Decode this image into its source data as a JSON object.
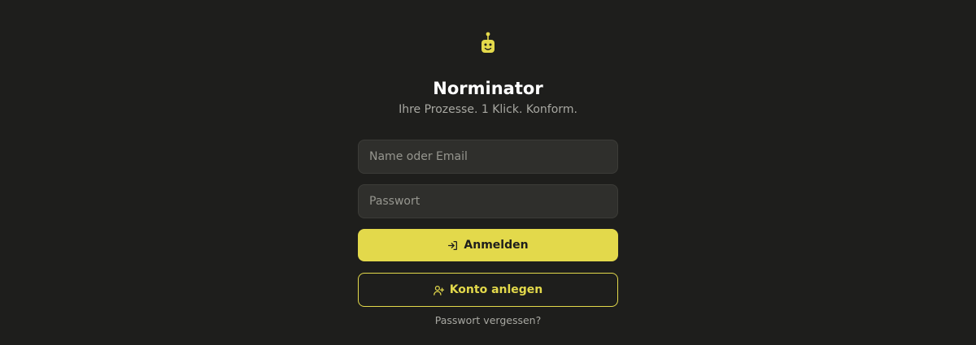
{
  "app": {
    "title": "Norminator",
    "tagline": "Ihre Prozesse. 1 Klick. Konform.",
    "logo_icon": "robot-head-icon"
  },
  "login_form": {
    "name_placeholder": "Name oder Email",
    "name_value": "",
    "password_placeholder": "Passwort",
    "password_value": "",
    "login_label": "Anmelden",
    "login_icon": "log-in-icon",
    "register_label": "Konto anlegen",
    "register_icon": "user-plus-icon",
    "forgot_label": "Passwort vergessen?"
  },
  "colors": {
    "background": "#1e1e1c",
    "accent": "#e3d94b",
    "field_bg": "#2f2f2c",
    "muted_text": "#a8a8a2"
  }
}
